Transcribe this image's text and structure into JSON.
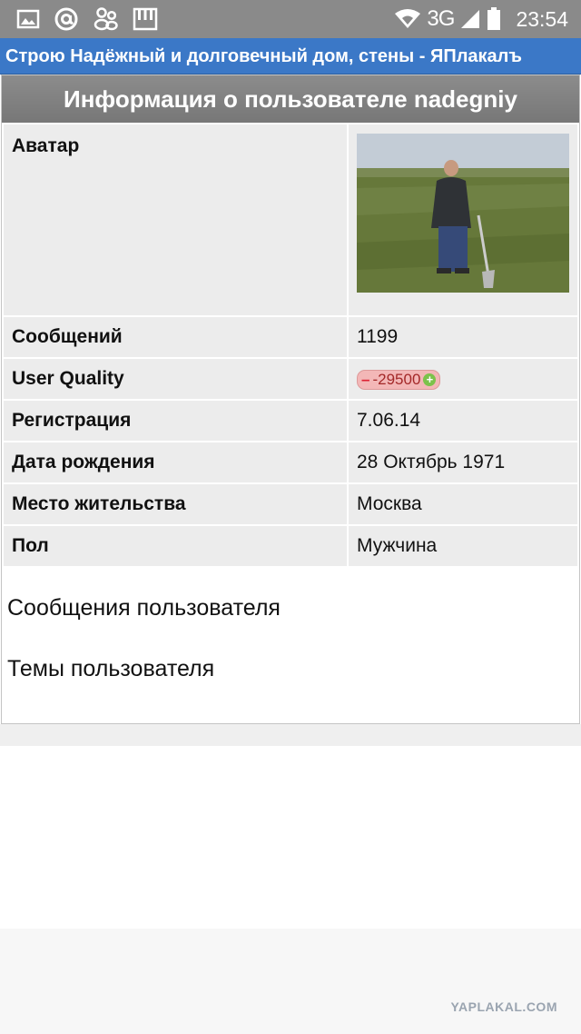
{
  "status_bar": {
    "left_icons": [
      "gallery-icon",
      "at-icon",
      "people-icon",
      "piano-keys-icon"
    ],
    "network": "3G",
    "time": "23:54"
  },
  "title_bar": {
    "title": "Строю Надёжный и долговечный дом, стены - ЯПлакалъ"
  },
  "panel": {
    "header": "Информация о пользователе nadegniy",
    "rows": {
      "avatar": {
        "label": "Аватар"
      },
      "posts": {
        "label": "Сообщений",
        "value": "1199"
      },
      "quality": {
        "label": "User Quality",
        "value": "-29500"
      },
      "registration": {
        "label": "Регистрация",
        "value": "7.06.14"
      },
      "birthday": {
        "label": "Дата рождения",
        "value": "28 Октябрь 1971"
      },
      "location": {
        "label": "Место жительства",
        "value": "Москва"
      },
      "gender": {
        "label": "Пол",
        "value": "Мужчина"
      }
    },
    "links": {
      "user_posts": "Сообщения пользователя",
      "user_topics": "Темы пользователя"
    }
  },
  "footer": {
    "logo": "YAPLAKAL.COM"
  },
  "colors": {
    "status_bar": "#8a8a8a",
    "title_bar": "#3b78c7",
    "panel_header": "#808080",
    "row_bg": "#ececec"
  }
}
